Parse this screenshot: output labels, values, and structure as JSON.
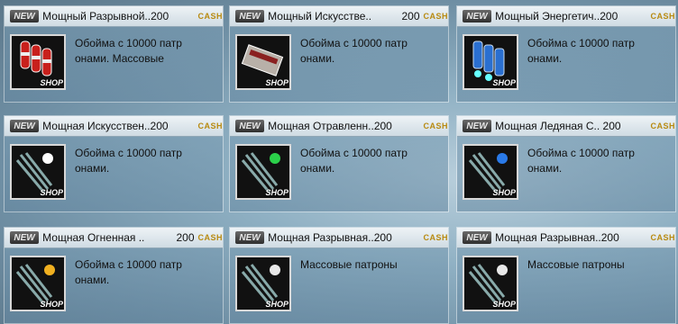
{
  "items": [
    {
      "name": "Мощный Разрывной..200",
      "price": "",
      "currency": "CASH",
      "badge": "NEW",
      "shop": "SHOP",
      "desc": "Обойма с 10000 патр\nонами. Массовые",
      "icon": "red-ammo-icon"
    },
    {
      "name": "Мощный Искусстве..",
      "price": "200",
      "currency": "CASH",
      "badge": "NEW",
      "shop": "SHOP",
      "desc": "Обойма с 10000 патр\nонами.",
      "icon": "ammo-box-icon"
    },
    {
      "name": "Мощный Энергетич..200",
      "price": "",
      "currency": "CASH",
      "badge": "NEW",
      "shop": "SHOP",
      "desc": "Обойма с 10000 патр\nонами.",
      "icon": "energy-ammo-icon"
    },
    {
      "name": "Мощная Искусствен..200",
      "price": "",
      "currency": "CASH",
      "badge": "NEW",
      "shop": "SHOP",
      "desc": "Обойма с 10000 патр\nонами.",
      "icon": "crossbow-bolts-icon"
    },
    {
      "name": "Мощная Отравленн..200",
      "price": "",
      "currency": "CASH",
      "badge": "NEW",
      "shop": "SHOP",
      "desc": "Обойма с 10000 патр\nонами.",
      "icon": "poison-bolts-icon"
    },
    {
      "name": "Мощная Ледяная С.. 200",
      "price": "",
      "currency": "CASH",
      "badge": "NEW",
      "shop": "SHOP",
      "desc": "Обойма с 10000 патр\nонами.",
      "icon": "ice-bolts-icon"
    },
    {
      "name": "Мощная Огненная ..",
      "price": "200",
      "currency": "CASH",
      "badge": "NEW",
      "shop": "SHOP",
      "desc": "Обойма с 10000 патр\nонами.",
      "icon": "fire-bolts-icon"
    },
    {
      "name": "Мощная Разрывная..200",
      "price": "",
      "currency": "CASH",
      "badge": "NEW",
      "shop": "SHOP",
      "desc": "Массовые патроны",
      "icon": "explosive-bolts-icon"
    },
    {
      "name": "Мощная Разрывная..200",
      "price": "",
      "currency": "CASH",
      "badge": "NEW",
      "shop": "SHOP",
      "desc": "Массовые патроны",
      "icon": "explosive-bolts-icon"
    }
  ],
  "colors": {
    "red-ammo-icon": "#c8201c",
    "ammo-box-icon": "#b8b0a8",
    "energy-ammo-icon": "#2a6fd0",
    "crossbow-bolts-icon": "#ffffff",
    "poison-bolts-icon": "#2bd04a",
    "ice-bolts-icon": "#2a7ae8",
    "fire-bolts-icon": "#f0b020",
    "explosive-bolts-icon": "#e8e8e8"
  }
}
